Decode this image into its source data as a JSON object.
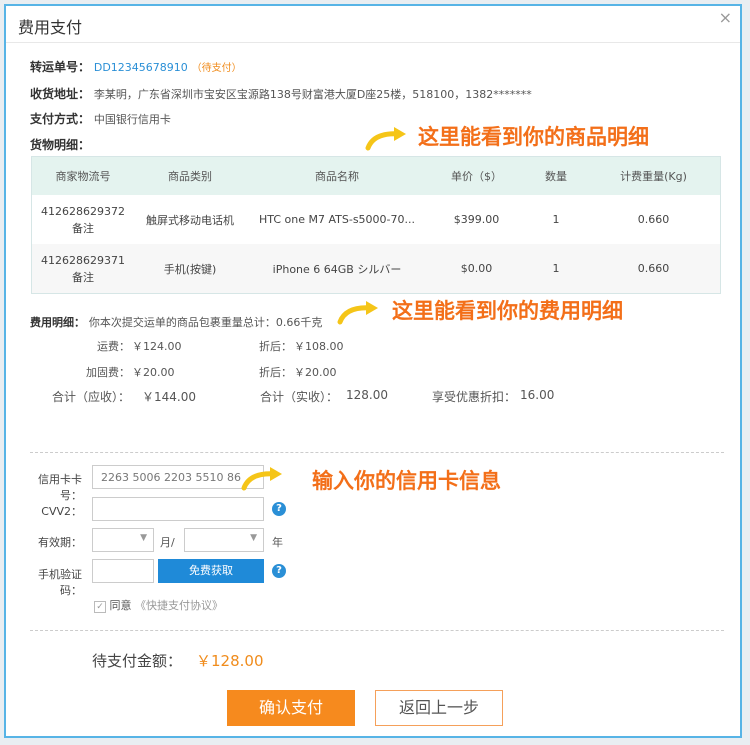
{
  "dialog": {
    "title": "费用支付",
    "close_icon": "×"
  },
  "order": {
    "no_label": "转运单号：",
    "no_value": "DD12345678910",
    "status": "（待支付）",
    "addr_label": "收货地址：",
    "addr_value": "李某明，广东省深圳市宝安区宝源路138号财富港大厦D座25楼，518100，1382*******",
    "pay_label": "支付方式：",
    "pay_value": "中国银行信用卡",
    "goods_label": "货物明细："
  },
  "annotations": {
    "goods": "这里能看到你的商品明细",
    "fees": "这里能看到你的费用明细",
    "card": "输入你的信用卡信息"
  },
  "goods_table": {
    "headers": [
      "商家物流号",
      "商品类别",
      "商品名称",
      "单价（$）",
      "数量",
      "计费重量(Kg)"
    ],
    "rows": [
      {
        "no": "412628629372",
        "note": "备注",
        "category": "触屏式移动电话机",
        "name": "HTC one M7 ATS-s5000-70...",
        "price": "$399.00",
        "qty": "1",
        "weight": "0.660"
      },
      {
        "no": "412628629371",
        "note": "备注",
        "category": "手机(按键)",
        "name": "iPhone 6 64GB シルバー",
        "price": "$0.00",
        "qty": "1",
        "weight": "0.660"
      }
    ]
  },
  "fees": {
    "label": "费用明细：",
    "summary": "你本次提交运单的商品包裹重量总计：0.66千克",
    "freight_label": "运费：",
    "freight": "￥124.00",
    "freight_disc_label": "折后：",
    "freight_disc": "￥108.00",
    "reinforce_label": "加固费：",
    "reinforce": "￥20.00",
    "reinforce_disc_label": "折后：",
    "reinforce_disc": "￥20.00",
    "due_label": "合计（应收）：",
    "due": "￥144.00",
    "paid_label": "合计（实收）：",
    "paid": "128.00",
    "discount_label": "享受优惠折扣：",
    "discount": "16.00"
  },
  "card_form": {
    "card_label": "信用卡卡号：",
    "card_value": "2263  5006 2203 5510 86",
    "cvv_label": "CVV2：",
    "exp_label": "有效期：",
    "month_unit": "月/",
    "year_unit": "年",
    "sms_label": "手机验证码：",
    "get_code": "免费获取",
    "help_icon": "?",
    "agree_label": "同意",
    "agree_link": "《快捷支付协议》"
  },
  "total": {
    "label": "待支付金额：",
    "value": "￥128.00"
  },
  "buttons": {
    "confirm": "确认支付",
    "back": "返回上一步"
  },
  "colors": {
    "accent": "#f68a1e",
    "link": "#2a8fd6",
    "border": "#57b4e6"
  }
}
